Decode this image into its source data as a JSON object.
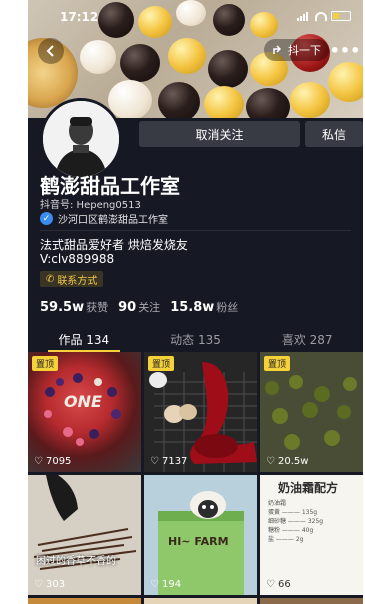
{
  "status_bar": {
    "time": "17:12"
  },
  "header": {
    "share_label": "抖一下"
  },
  "actions": {
    "unfollow": "取消关注",
    "message": "私信"
  },
  "profile": {
    "name": "鹤澎甜品工作室",
    "douyin_id": "抖音号: Hepeng0513",
    "verified_text": "沙河口区鹤澎甜品工作室",
    "bio_line1": "法式甜品爱好者 烘焙发烧友",
    "bio_line2": "V:clv889988",
    "contact_label": "联系方式"
  },
  "stats": [
    {
      "num": "59.5w",
      "label": "获赞"
    },
    {
      "num": "90",
      "label": "关注"
    },
    {
      "num": "15.8w",
      "label": "粉丝"
    }
  ],
  "tabs": [
    {
      "label": "作品 134",
      "active": true
    },
    {
      "label": "动态 135",
      "active": false
    },
    {
      "label": "喜欢 287",
      "active": false
    }
  ],
  "posts": [
    {
      "pinned": true,
      "pin_label": "置顶",
      "likes": "7095",
      "overlay": "ONE"
    },
    {
      "pinned": true,
      "pin_label": "置顶",
      "likes": "7137"
    },
    {
      "pinned": true,
      "pin_label": "置顶",
      "likes": "20.5w"
    },
    {
      "pinned": false,
      "likes": "303",
      "caption": "困过的香草不香的"
    },
    {
      "pinned": false,
      "likes": "194",
      "overlay": "HI~ FARM"
    },
    {
      "pinned": false,
      "likes": "66",
      "overlay": "奶油霜配方",
      "recipe": [
        "奶油霜",
        "蛋黄 ——— 135g",
        "细砂糖 ——— 325g",
        "糖粉 ——— 40g",
        "盐 ——— 2g"
      ]
    }
  ],
  "colors": {
    "background": "#161823",
    "accent": "#f5d13a",
    "button": "#393b44",
    "verified": "#3b8cf0"
  }
}
